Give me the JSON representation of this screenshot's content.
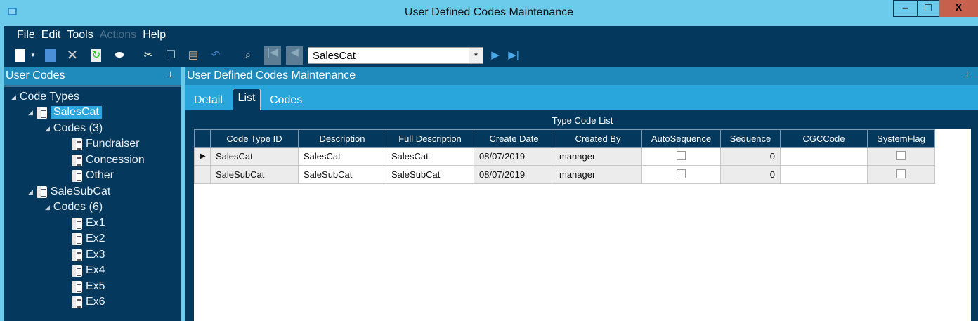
{
  "window": {
    "title": "User Defined Codes Maintenance",
    "minimize": "–",
    "maximize": "□",
    "close": "X"
  },
  "menu": [
    "File",
    "Edit",
    "Tools",
    "Actions",
    "Help"
  ],
  "toolbar": {
    "record_selector": "SalesCat"
  },
  "left_panel": {
    "title": "User Codes",
    "pin": "ꟸ",
    "tree": {
      "root": "Code Types",
      "types": [
        {
          "label": "SalesCat",
          "group": "Codes (3)",
          "codes": [
            "Fundraiser",
            "Concession",
            "Other"
          ]
        },
        {
          "label": "SaleSubCat",
          "group": "Codes (6)",
          "codes": [
            "Ex1",
            "Ex2",
            "Ex3",
            "Ex4",
            "Ex5",
            "Ex6"
          ]
        }
      ]
    }
  },
  "main_panel": {
    "title": "User Defined Codes Maintenance",
    "tabs": [
      "Detail",
      "List",
      "Codes"
    ],
    "active_tab": "List",
    "grid": {
      "title": "Type Code List",
      "columns": [
        "Code Type ID",
        "Description",
        "Full Description",
        "Create Date",
        "Created By",
        "AutoSequence",
        "Sequence",
        "CGCCode",
        "SystemFlag"
      ],
      "rows": [
        {
          "id": "SalesCat",
          "desc": "SalesCat",
          "full": "SalesCat",
          "date": "08/07/2019",
          "by": "manager",
          "auto": false,
          "seq": "0",
          "cgc": "",
          "sys": false
        },
        {
          "id": "SaleSubCat",
          "desc": "SaleSubCat",
          "full": "SaleSubCat",
          "date": "08/07/2019",
          "by": "manager",
          "auto": false,
          "seq": "0",
          "cgc": "",
          "sys": false
        }
      ]
    }
  }
}
